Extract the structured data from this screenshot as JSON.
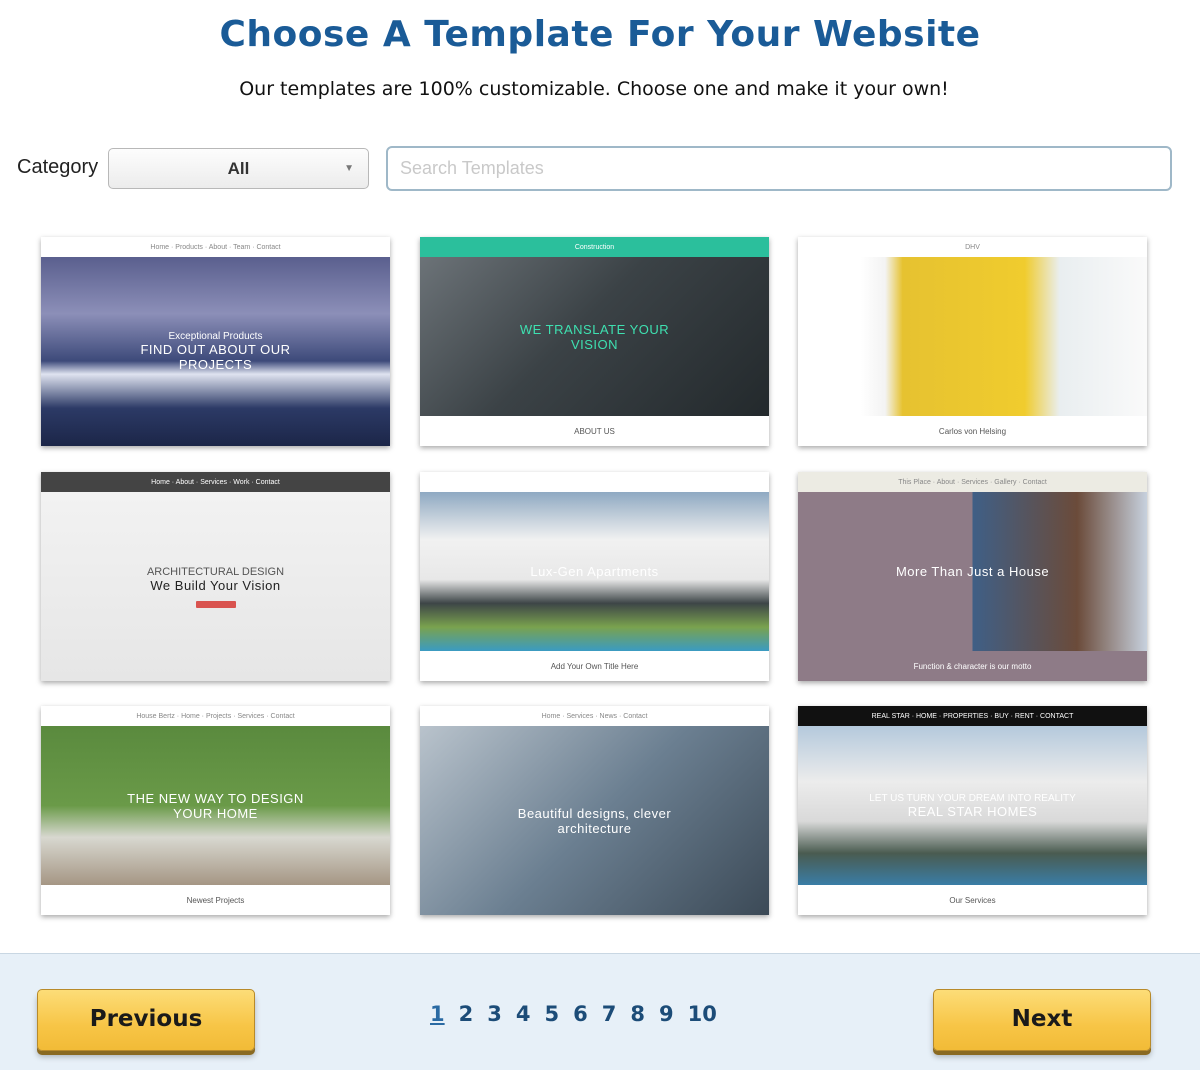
{
  "header": {
    "title": "Choose A Template For Your Website",
    "subtitle": "Our templates are 100% customizable. Choose one and make it your own!"
  },
  "filters": {
    "category_label": "Category",
    "category_value": "All",
    "search_placeholder": "Search Templates"
  },
  "templates": [
    {
      "nav_color": "#ffffff",
      "nav_text": "Home · Products · About · Team · Contact",
      "hero_bg": "linear-gradient(#5a5f8e 0%,#8c8fb8 30%,#3d4a7a 55%,#dfe3f0 62%,#2c3a66 80%,#1c2648)",
      "h2": "Exceptional Products",
      "h1": "FIND OUT ABOUT OUR PROJECTS",
      "below": "",
      "below_bg": "#fff"
    },
    {
      "nav_color": "#2bbf9c",
      "nav_text": "Construction",
      "hero_bg": "linear-gradient(135deg,#6c7378,#3b4246 45%,#23292c)",
      "h2": "",
      "h1": "WE TRANSLATE YOUR VISION",
      "h1_color": "#3ee0b0",
      "below": "ABOUT US",
      "below_bg": "#fff"
    },
    {
      "nav_color": "#ffffff",
      "nav_text": "DHV",
      "hero_bg": "linear-gradient(90deg,#fff 0%,#fff 18%,#f3f3f3 25%,#e6c230 30%,#f0cc2e 65%,#e9eef0 75%,#fafafa)",
      "h2": "",
      "h1": "",
      "below": "Carlos von Helsing",
      "below_bg": "#fff"
    },
    {
      "nav_color": "#444444",
      "nav_text": "Home · About · Services · Work · Contact",
      "hero_bg": "linear-gradient(#f2f2f2,#e6e6e6)",
      "h2": "ARCHITECTURAL DESIGN",
      "h1": "We Build Your Vision",
      "dark": true,
      "below": "",
      "below_bg": "#eee"
    },
    {
      "nav_color": "#ffffff",
      "nav_text": "",
      "hero_bg": "linear-gradient(#8fa9c2 0%,#f1f1f1 30%,#e8e8e8 55%,#3d4547 70%,#7aa24e 85%,#3a9bc2)",
      "h2": "",
      "h1": "Lux-Gen Apartments",
      "below": "Add Your Own Title Here",
      "below_bg": "#fff"
    },
    {
      "nav_color": "#ecebe3",
      "nav_text": "This Place · About · Services · Gallery · Contact",
      "hero_bg": "linear-gradient(90deg,#8e7b87 0%,#8e7b87 50%,#3f5f86 50%,#6b4b3a 80%,#c7d1de)",
      "h2": "",
      "h1": "More Than Just a House",
      "below": "Function & character is our motto",
      "below_bg": "#8e7b87",
      "below_color": "#fff"
    },
    {
      "nav_color": "#ffffff",
      "nav_text": "House Bertz · Home · Projects · Services · Contact",
      "hero_bg": "linear-gradient(#5a8a3e 0%,#6a9a48 50%,#d8d8d0 70%,#a59684)",
      "h2": "",
      "h1": "THE NEW WAY TO DESIGN YOUR HOME",
      "below": "Newest Projects",
      "below_bg": "#fff"
    },
    {
      "nav_color": "#ffffff",
      "nav_text": "Home · Services · News · Contact",
      "hero_bg": "linear-gradient(135deg,#b9c3cc,#6b7f91 50%,#3c4a57)",
      "h2": "",
      "h1": "Beautiful designs, clever architecture",
      "below": "",
      "below_bg": "#fff"
    },
    {
      "nav_color": "#111111",
      "nav_text": "REAL STAR · HOME · PROPERTIES · BUY · RENT · CONTACT",
      "hero_bg": "linear-gradient(#b4c9dc 0%,#ececec 35%,#d9d9d9 60%,#4a5b50 80%,#3a7da6)",
      "h2": "LET US TURN YOUR DREAM INTO REALITY",
      "h1": "REAL STAR HOMES",
      "below": "Our Services",
      "below_bg": "#fff"
    }
  ],
  "pagination": {
    "previous_label": "Previous",
    "next_label": "Next",
    "current": "1",
    "pages": [
      "1",
      "2",
      "3",
      "4",
      "5",
      "6",
      "7",
      "8",
      "9",
      "10"
    ]
  },
  "colors": {
    "title": "#1a5b97",
    "button": "#f7c546",
    "footer_bg": "#e7f0f8"
  }
}
